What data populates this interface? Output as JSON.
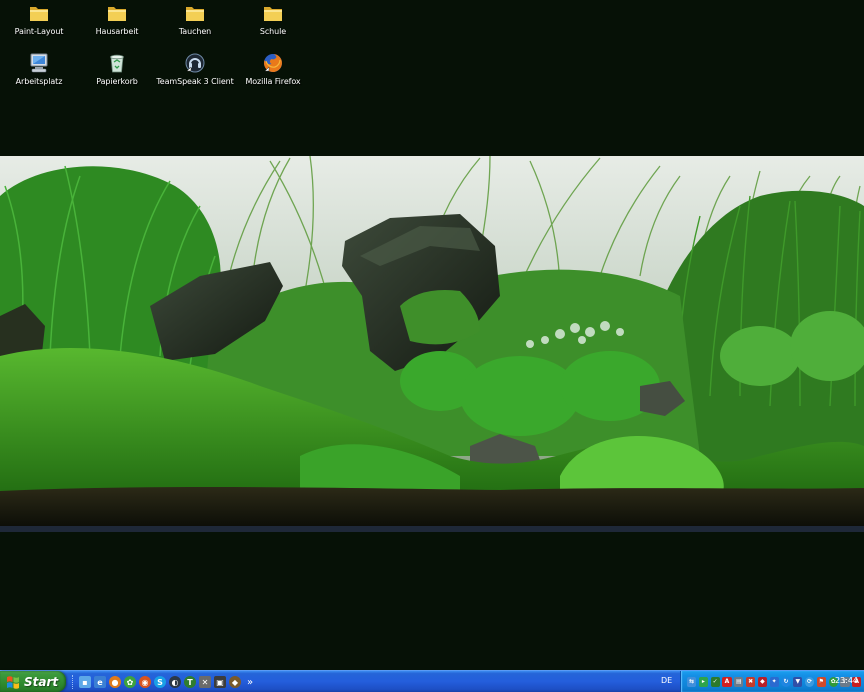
{
  "desktop": {
    "icons": [
      {
        "label": "Paint-Layout",
        "icon": "folder-icon"
      },
      {
        "label": "Hausarbeit",
        "icon": "folder-icon"
      },
      {
        "label": "Tauchen",
        "icon": "folder-icon"
      },
      {
        "label": "Schule",
        "icon": "folder-icon"
      },
      {
        "label": "Arbeitsplatz",
        "icon": "my-computer-icon"
      },
      {
        "label": "Papierkorb",
        "icon": "recycle-bin-icon"
      },
      {
        "label": "TeamSpeak 3 Client",
        "icon": "teamspeak-icon"
      },
      {
        "label": "Mozilla Firefox",
        "icon": "firefox-icon"
      }
    ],
    "wallpaper": "aquascape-wallpaper"
  },
  "taskbar": {
    "start_label": "Start",
    "quicklaunch_overflow": "»",
    "language": "DE",
    "clock": "23:44"
  },
  "colors": {
    "desktop_background": "#061106",
    "taskbar_blue": "#245edc",
    "start_green": "#3c9a3c",
    "tray_blue": "#0f84d8",
    "folder_yellow": "#f3cf55"
  }
}
